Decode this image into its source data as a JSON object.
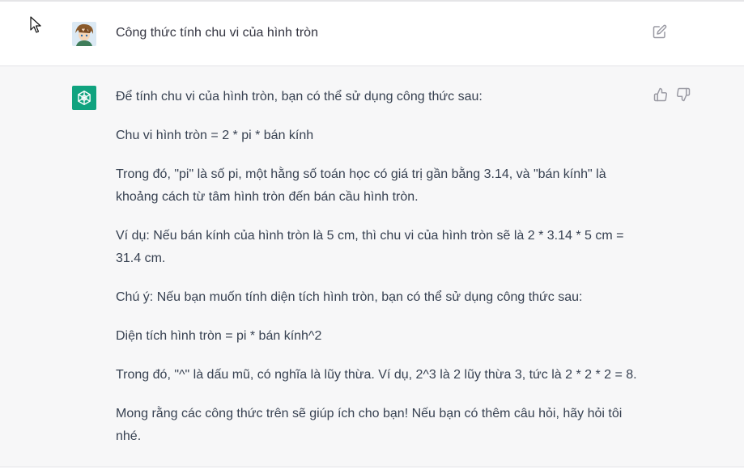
{
  "user_message": {
    "text": "Công thức tính chu vi của hình tròn",
    "avatar_icon": "user-avatar-image",
    "edit_icon": "edit-icon"
  },
  "assistant_message": {
    "avatar_icon": "openai-logo-icon",
    "avatar_color": "#10a37f",
    "paragraphs": [
      "Để tính chu vi của hình tròn, bạn có thể sử dụng công thức sau:",
      "Chu vi hình tròn = 2 * pi * bán kính",
      "Trong đó, \"pi\" là số pi, một hằng số toán học có giá trị gần bằng 3.14, và \"bán kính\" là khoảng cách từ tâm hình tròn đến bán cầu hình tròn.",
      "Ví dụ: Nếu bán kính của hình tròn là 5 cm, thì chu vi của hình tròn sẽ là 2 * 3.14 * 5 cm = 31.4 cm.",
      "Chú ý: Nếu bạn muốn tính diện tích hình tròn, bạn có thể sử dụng công thức sau:",
      "Diện tích hình tròn = pi * bán kính^2",
      "Trong đó, \"^\" là dấu mũ, có nghĩa là lũy thừa. Ví dụ, 2^3 là 2 lũy thừa 3, tức là 2 * 2 * 2 = 8.",
      "Mong rằng các công thức trên sẽ giúp ích cho bạn! Nếu bạn có thêm câu hỏi, hãy hỏi tôi nhé."
    ],
    "feedback_icons": [
      "thumbs-up-icon",
      "thumbs-down-icon"
    ]
  }
}
